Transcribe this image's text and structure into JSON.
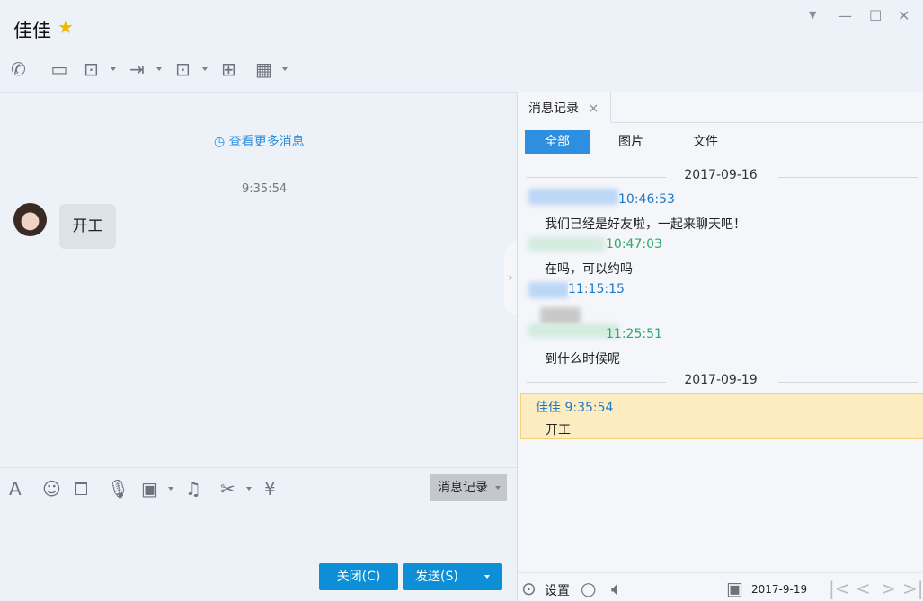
{
  "header": {
    "title": "佳佳",
    "badge_icon": "star-vip-icon"
  },
  "window_controls": [
    "menu-dropdown",
    "minimize",
    "maximize",
    "close"
  ],
  "toolbar": [
    "phone-icon",
    "video-icon",
    "screen-share-icon",
    "file-transfer-icon",
    "remote-desktop-icon",
    "new-discussion-icon",
    "apps-icon"
  ],
  "chat": {
    "load_more": "查看更多消息",
    "time": "9:35:54",
    "message": "开工"
  },
  "input_toolbar": {
    "history_button": "消息记录",
    "icons": [
      "font-icon",
      "emoji-icon",
      "shake-icon",
      "voice-icon",
      "image-icon",
      "music-icon",
      "screenshot-icon",
      "red-packet-icon"
    ]
  },
  "buttons": {
    "close": "关闭(C)",
    "send": "发送(S)"
  },
  "history": {
    "tab": "消息记录",
    "filters": [
      "全部",
      "图片",
      "文件"
    ],
    "groups": [
      {
        "date": "2017-09-16",
        "items": [
          {
            "time": "10:46:53",
            "text": "我们已经是好友啦，一起来聊天吧！",
            "color": "#1e78c8"
          },
          {
            "time": "10:47:03",
            "text": "在吗，可以约吗",
            "color": "#2eaa6a"
          },
          {
            "time": "11:15:15",
            "text": "",
            "color": "#1e78c8"
          },
          {
            "time": "11:25:51",
            "text": "到什么时候呢",
            "color": "#2eaa6a"
          }
        ]
      },
      {
        "date": "2017-09-19",
        "items": [
          {
            "name": "佳佳",
            "time": "9:35:54",
            "text": "开工",
            "color": "#1e78c8"
          }
        ]
      }
    ],
    "footer": {
      "settings": "设置",
      "date": "2017-9-19"
    }
  }
}
